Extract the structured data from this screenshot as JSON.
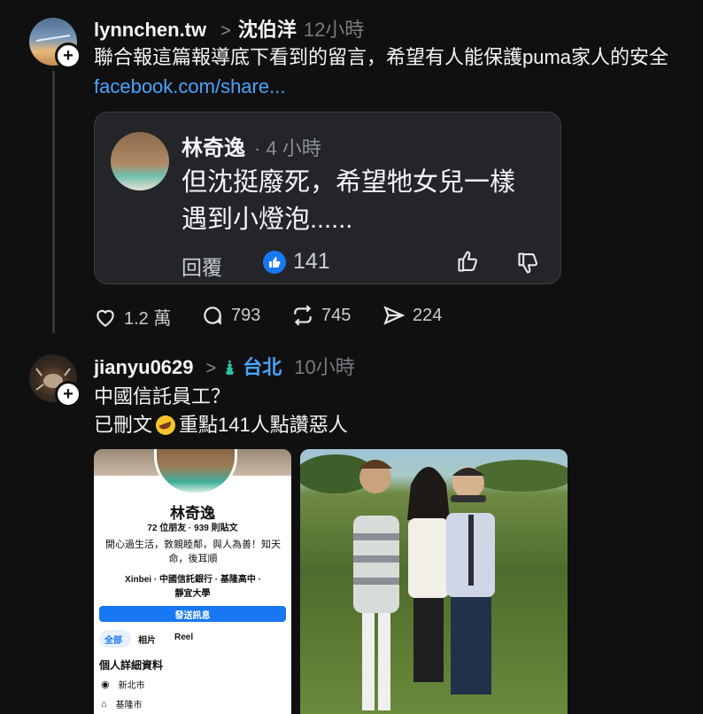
{
  "post1": {
    "username": "lynnchen.tw",
    "chevron": ">",
    "reply_to": "沈伯洋",
    "time": "12小時",
    "text": "聯合報這篇報導底下看到的留言，希望有人能保護puma家人的安全",
    "link": "facebook.com/share...",
    "card": {
      "name": "林奇逸",
      "sep_time": "· 4 小時",
      "line1": "但沈挺廢死，希望牠女兒一樣",
      "line2": "遇到小燈泡......",
      "reply_label": "回覆",
      "likes": "141"
    },
    "stats": {
      "likes": "1.2 萬",
      "comments": "793",
      "reposts": "745",
      "shares": "224"
    }
  },
  "post2": {
    "username": "jianyu0629",
    "chevron": ">",
    "location": "台北",
    "time": "10小時",
    "line1": "中國信託員工？",
    "line2a": "已刪文",
    "line2b": "重點141人點讚惡人"
  },
  "profile_shot": {
    "name": "林奇逸",
    "counts": "72 位朋友 · 939 則貼文",
    "bio": "開心過生活，敦親睦鄰，與人為善！知天命，後耳順",
    "info_row1": "Xinbei · 中國信託銀行 · 基隆高中 ·",
    "info_row2": "靜宜大學",
    "message_button": "發送訊息",
    "tabs": [
      "全部",
      "相片",
      "Reel"
    ],
    "details_heading": "個人詳細資料",
    "detail1": "新北市",
    "detail2": "基隆市"
  },
  "colors": {
    "link": "#4aa3ff",
    "like_blue": "#1877f2",
    "bg": "#101010"
  }
}
